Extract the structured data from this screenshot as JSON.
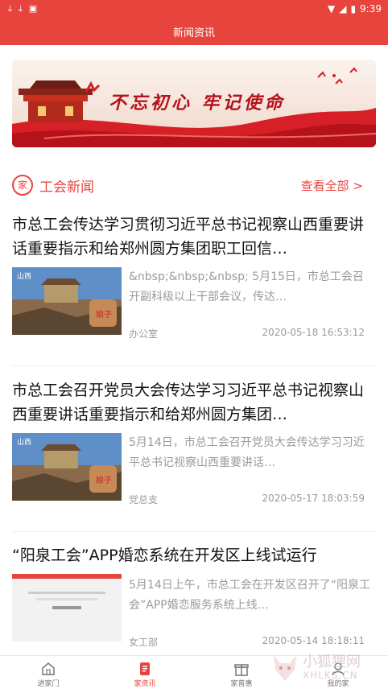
{
  "status_bar": {
    "time": "9:39",
    "icons": [
      "download-icon",
      "download-icon",
      "notification-icon",
      "wifi-icon",
      "signal-icon",
      "battery-icon"
    ]
  },
  "header": {
    "title": "新闻资讯"
  },
  "banner": {
    "slogan": "不忘初心  牢记使命"
  },
  "section": {
    "badge": "家",
    "title": "工会新闻",
    "more": "查看全部 >"
  },
  "news": [
    {
      "title": "市总工会传达学习贯彻习近平总书记视察山西重要讲话重要指示和给郑州圆方集团职工回信…",
      "summary": "&nbsp;&nbsp;&nbsp; 5月15日，市总工会召开副科级以上干部会议，传达…",
      "dept": "办公室",
      "time": "2020-05-18 16:53:12"
    },
    {
      "title": "市总工会召开党员大会传达学习习近平总书记视察山西重要讲话重要指示和给郑州圆方集团…",
      "summary": "5月14日，市总工会召开党员大会传达学习习近平总书记视察山西重要讲话…",
      "dept": "党总支",
      "time": "2020-05-17 18:03:59"
    },
    {
      "title": "“阳泉工会”APP婚恋系统在开发区上线试运行",
      "summary": "5月14日上午，市总工会在开发区召开了“阳泉工会”APP婚恋服务系统上线…",
      "dept": "女工部",
      "time": "2020-05-14 18:18:11"
    }
  ],
  "tabbar": {
    "tabs": [
      {
        "label": "进家门",
        "icon": "home-icon"
      },
      {
        "label": "家资讯",
        "icon": "news-icon"
      },
      {
        "label": "家普惠",
        "icon": "gift-icon"
      },
      {
        "label": "我的家",
        "icon": "user-icon"
      }
    ]
  },
  "watermark": {
    "line1": "小狐狸网",
    "line2": "XHLKS.CN"
  },
  "colors": {
    "accent": "#e8443e",
    "muted_text": "#9a9a9a"
  }
}
